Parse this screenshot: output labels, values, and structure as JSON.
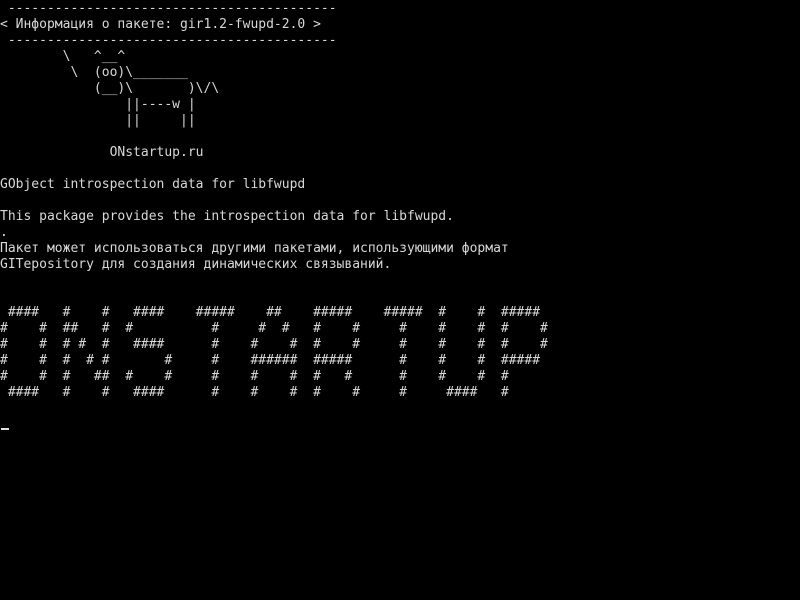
{
  "terminal": {
    "cowsay_box": {
      "top_border": " ------------------------------------------",
      "message": "< Информация о пакете: gir1.2-fwupd-2.0 >",
      "bottom_border": " ------------------------------------------"
    },
    "cow_art": [
      "        \\   ^__^",
      "         \\  (oo)\\_______",
      "            (__)\\       )\\/\\",
      "                ||----w |",
      "                ||     ||"
    ],
    "site": "              ONstartup.ru",
    "package_summary": "GObject introspection data for libfwupd",
    "description_en": "This package provides the introspection data for libfwupd.",
    "separator_dot": ".",
    "description_ru_line1": "Пакет может использоваться другими пакетами, использующими формат",
    "description_ru_line2": "GITepository для создания динамических связываний.",
    "banner_text": " ####   #    #   ####    #####    ##    #####    #####  #    #  #####\n#    #  ##   #  #          #     #  #   #    #     #    #    #  #    #\n#    #  # #  #   ####      #    #    #  #    #     #    #    #  #    #\n#    #  #  # #       #     #    ######  #####      #    #    #  #####\n#    #  #   ##  #    #     #    #    #  #   #      #    #    #  #\n ####   #    #   ####      #    #    #  #    #     #     ####   #"
  }
}
